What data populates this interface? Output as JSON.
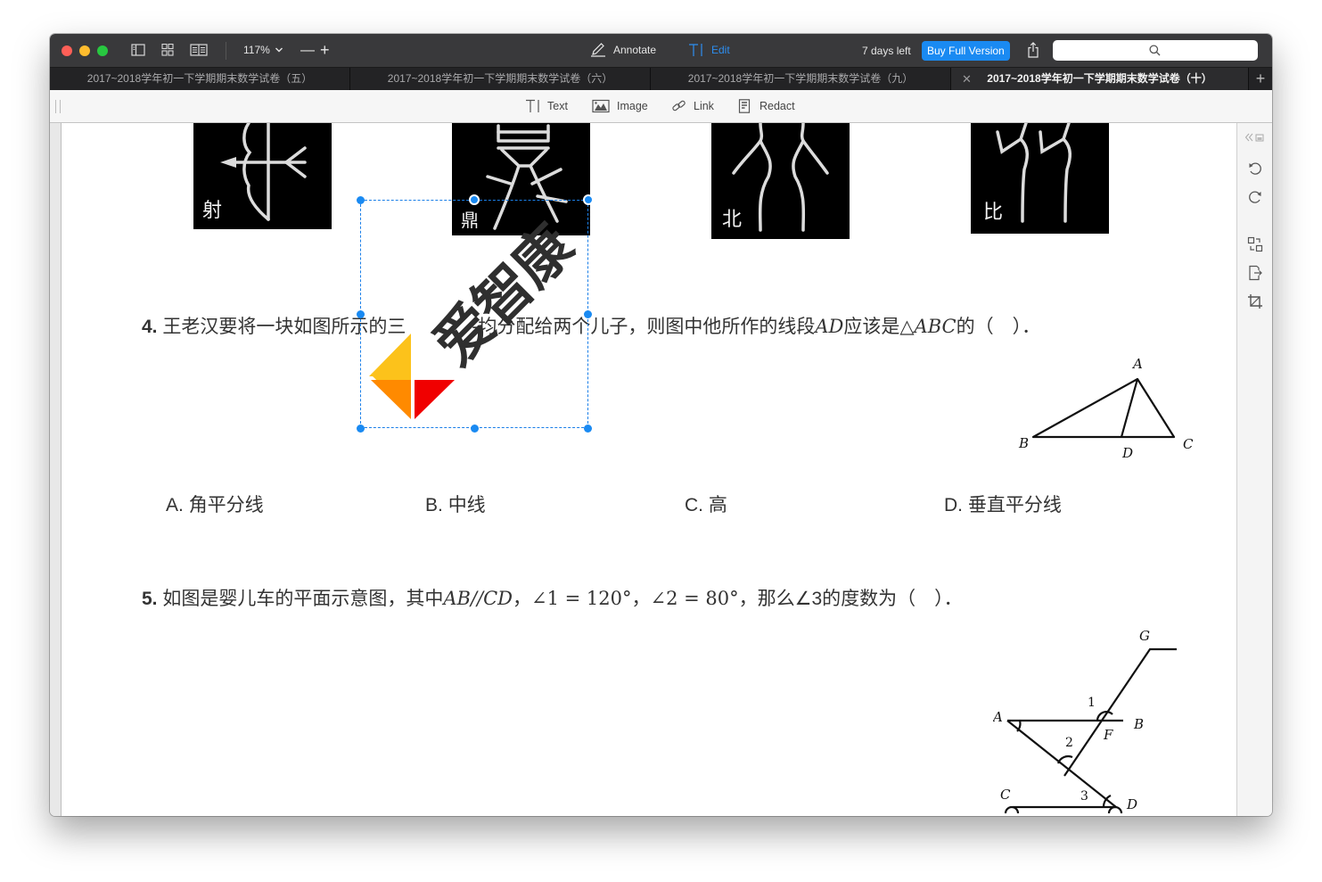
{
  "toolbar": {
    "zoom_level": "117%",
    "annotate_label": "Annotate",
    "edit_label": "Edit",
    "trial_text": "7 days left",
    "buy_label": "Buy Full Version",
    "search_placeholder": ""
  },
  "tabs": [
    {
      "label": "2017~2018学年初一下学期期末数学试卷（五）",
      "active": false
    },
    {
      "label": "2017~2018学年初一下学期期末数学试卷（六）",
      "active": false
    },
    {
      "label": "2017~2018学年初一下学期期末数学试卷（九）",
      "active": false
    },
    {
      "label": "2017~2018学年初一下学期期末数学试卷（十）",
      "active": true
    }
  ],
  "edit_tools": {
    "text": "Text",
    "image": "Image",
    "link": "Link",
    "redact": "Redact"
  },
  "document": {
    "glyph_images": [
      {
        "label": "射"
      },
      {
        "label": "鼎"
      },
      {
        "label": "北"
      },
      {
        "label": "比"
      }
    ],
    "watermark": {
      "text": "爱智康"
    },
    "question4": {
      "number": "4.",
      "text_a": "王老汉要将一块如图所示的三",
      "text_b": "-均分配给两个儿子，则图中他所作的线段",
      "math_ad": "AD",
      "text_c": "应该是△",
      "math_abc": "ABC",
      "text_d": "的（　）．",
      "figure_labels": {
        "A": "A",
        "B": "B",
        "C": "C",
        "D": "D"
      },
      "options": [
        {
          "letter": "A.",
          "text": "角平分线"
        },
        {
          "letter": "B.",
          "text": "中线"
        },
        {
          "letter": "C.",
          "text": "高"
        },
        {
          "letter": "D.",
          "text": "垂直平分线"
        }
      ]
    },
    "question5": {
      "number": "5.",
      "text_a": "如图是婴儿车的平面示意图，其中",
      "math_ab_cd": "AB//CD",
      "sep1": "，",
      "angle1": "∠1 = 120°",
      "sep2": "，",
      "angle2": "∠2 = 80°",
      "text_b": "，那么∠3的度数为（　）．",
      "figure_labels": {
        "A": "A",
        "B": "B",
        "C": "C",
        "D": "D",
        "F": "F",
        "G": "G",
        "n1": "1",
        "n2": "2",
        "n3": "3"
      }
    }
  }
}
